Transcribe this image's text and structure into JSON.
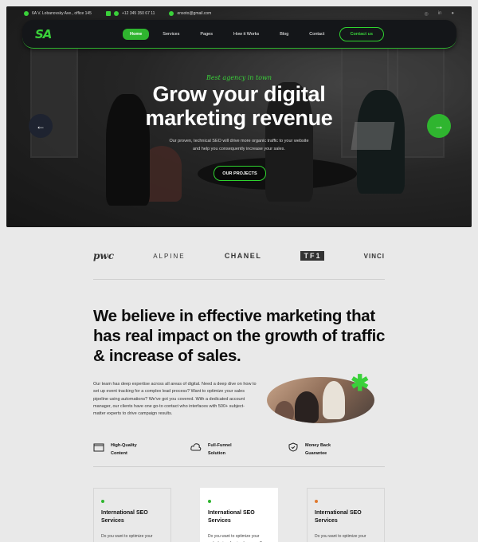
{
  "topbar": {
    "address": "6A V. Lobanovsky Ave., office 145",
    "phone": "+12 345 350 67 11",
    "email": "ensoto@gmail.com",
    "socials": [
      "instagram-icon",
      "linkedin-icon",
      "facebook-icon"
    ]
  },
  "nav": {
    "logo": "SA",
    "items": [
      "Home",
      "Services",
      "Pages",
      "How it Works",
      "Blog",
      "Contact"
    ],
    "active": "Home",
    "cta": "Contact us"
  },
  "hero": {
    "tagline": "Best agency in town",
    "title_line1": "Grow your digital",
    "title_line2": "marketing revenue",
    "subtitle": "Our proven, technical SEO will drive more organic traffic to your website and help you consequently increase your sales.",
    "button": "OUR PROJECTS",
    "prev_icon": "arrow-left-icon",
    "next_icon": "arrow-right-icon"
  },
  "brands": [
    "pwc",
    "ALPINE",
    "CHANEL",
    "TF1",
    "VINCI"
  ],
  "about": {
    "headline": "We believe in effective marketing that has real impact on the growth of traffic & increase of sales.",
    "paragraph": "Our team has deep expertise across all areas of digital. Need a deep dive on how to set up event tracking for a complex lead process? Want to optimize your sales pipeline using automations? We've got you covered. With a dedicated account manager, our clients have one go-to contact who interfaces with 500+ subject-matter experts to drive campaign results."
  },
  "features": [
    {
      "line1": "High-Quality",
      "line2": "Content",
      "icon": "content-icon"
    },
    {
      "line1": "Full-Funnel",
      "line2": "Solution",
      "icon": "cloud-icon"
    },
    {
      "line1": "Money Back",
      "line2": "Guarantee",
      "icon": "shield-check-icon"
    }
  ],
  "cards": [
    {
      "title_line1": "International SEO",
      "title_line2": "Services",
      "desc": "Do you want to optimize your",
      "dot": "#2fb52f"
    },
    {
      "title_line1": "International SEO",
      "title_line2": "Services",
      "desc": "Do you want to optimize your website in a foreign language?",
      "dot": "#2fb52f"
    },
    {
      "title_line1": "International SEO",
      "title_line2": "Services",
      "desc": "Do you want to optimize your",
      "dot": "#e07a2f"
    }
  ],
  "colors": {
    "accent": "#2fb52f",
    "dark": "#141619"
  }
}
